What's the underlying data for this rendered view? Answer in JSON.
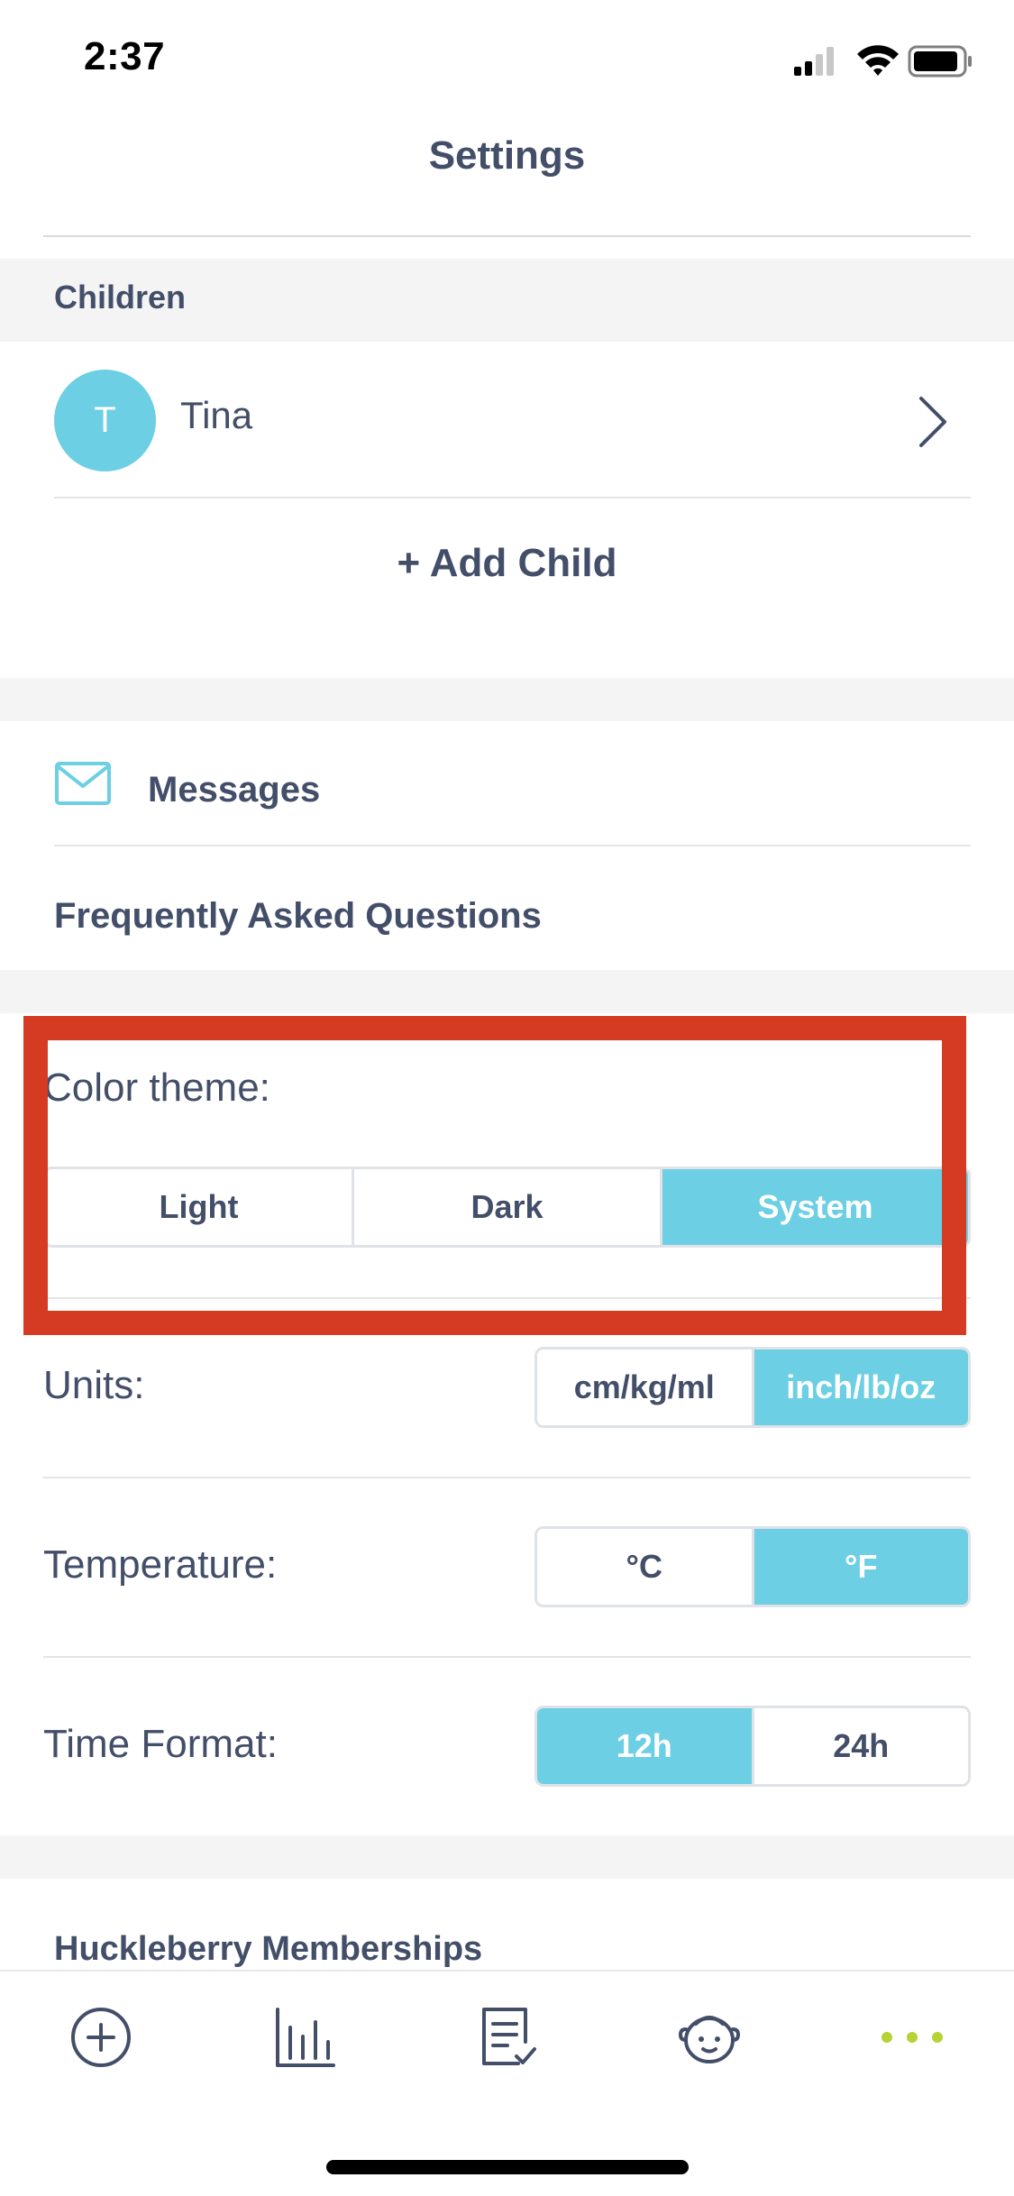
{
  "status_bar": {
    "time": "2:37",
    "icons": [
      "cellular-signal-icon",
      "wifi-icon",
      "battery-icon"
    ]
  },
  "header": {
    "title": "Settings"
  },
  "children_section": {
    "title": "Children",
    "child": {
      "avatar_initial": "T",
      "name": "Tina"
    },
    "add_child_label": "+ Add Child"
  },
  "links_section": {
    "messages_label": "Messages",
    "faq_label": "Frequently Asked Questions"
  },
  "preferences": {
    "color_theme": {
      "label": "Color theme:",
      "options": [
        "Light",
        "Dark",
        "System"
      ],
      "selected": "System"
    },
    "units": {
      "label": "Units:",
      "options": [
        "cm/kg/ml",
        "inch/lb/oz"
      ],
      "selected": "inch/lb/oz"
    },
    "temperature": {
      "label": "Temperature:",
      "options": [
        "°C",
        "°F"
      ],
      "selected": "°F"
    },
    "time_format": {
      "label": "Time Format:",
      "options": [
        "12h",
        "24h"
      ],
      "selected": "12h"
    }
  },
  "memberships_section": {
    "title": "Huckleberry Memberships"
  },
  "tab_bar": {
    "items": [
      "add-entry-icon",
      "charts-icon",
      "reports-icon",
      "child-face-icon",
      "more-dots-icon"
    ]
  },
  "colors": {
    "accent": "#6ccfe4",
    "text": "#434e69",
    "highlight_border": "#d53a22",
    "more_dots": "#b5d334",
    "band": "#f4f4f5"
  }
}
